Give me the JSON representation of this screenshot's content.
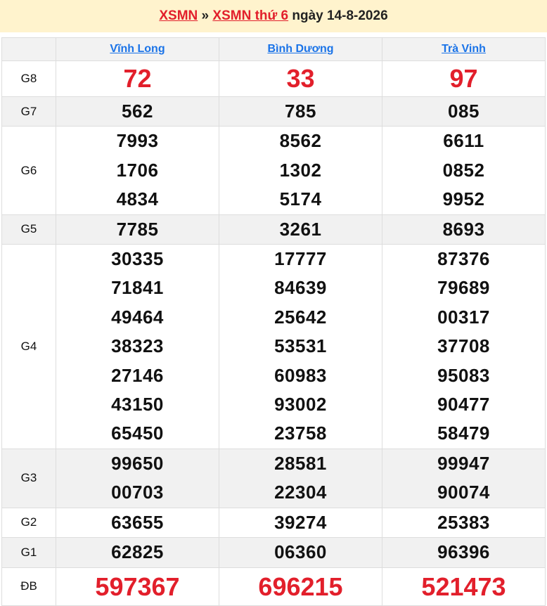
{
  "header": {
    "link1": "XSMN",
    "separator": "»",
    "link2": "XSMN thứ 6",
    "date_text": "ngày 14-8-2026"
  },
  "provinces": [
    "Vĩnh Long",
    "Bình Dương",
    "Trà Vinh"
  ],
  "prizes": [
    {
      "label": "G8",
      "results": [
        [
          "72"
        ],
        [
          "33"
        ],
        [
          "97"
        ]
      ]
    },
    {
      "label": "G7",
      "results": [
        [
          "562"
        ],
        [
          "785"
        ],
        [
          "085"
        ]
      ]
    },
    {
      "label": "G6",
      "results": [
        [
          "7993",
          "1706",
          "4834"
        ],
        [
          "8562",
          "1302",
          "5174"
        ],
        [
          "6611",
          "0852",
          "9952"
        ]
      ]
    },
    {
      "label": "G5",
      "results": [
        [
          "7785"
        ],
        [
          "3261"
        ],
        [
          "8693"
        ]
      ]
    },
    {
      "label": "G4",
      "results": [
        [
          "30335",
          "71841",
          "49464",
          "38323",
          "27146",
          "43150",
          "65450"
        ],
        [
          "17777",
          "84639",
          "25642",
          "53531",
          "60983",
          "93002",
          "23758"
        ],
        [
          "87376",
          "79689",
          "00317",
          "37708",
          "95083",
          "90477",
          "58479"
        ]
      ]
    },
    {
      "label": "G3",
      "results": [
        [
          "99650",
          "00703"
        ],
        [
          "28581",
          "22304"
        ],
        [
          "99947",
          "90074"
        ]
      ]
    },
    {
      "label": "G2",
      "results": [
        [
          "63655"
        ],
        [
          "39274"
        ],
        [
          "25383"
        ]
      ]
    },
    {
      "label": "G1",
      "results": [
        [
          "62825"
        ],
        [
          "06360"
        ],
        [
          "96396"
        ]
      ]
    },
    {
      "label": "ĐB",
      "results": [
        [
          "597367"
        ],
        [
          "696215"
        ],
        [
          "521473"
        ]
      ]
    }
  ]
}
